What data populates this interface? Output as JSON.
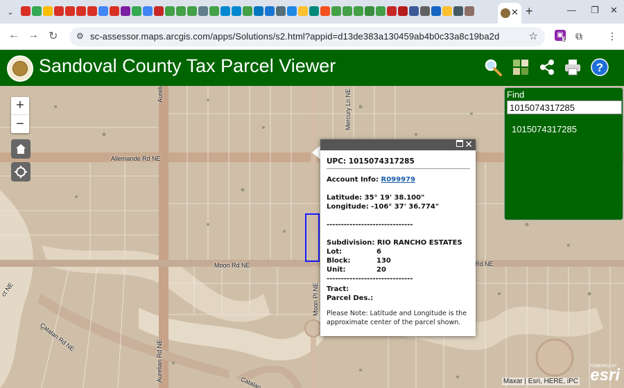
{
  "browser": {
    "url": "sc-assessor.maps.arcgis.com/apps/Solutions/s2.html?appid=d13de383a130459ab4b0c33a8c19ba2d",
    "favicon_colors": [
      "#d93025",
      "#34a853",
      "#fbbc04",
      "#d93025",
      "#d93025",
      "#d93025",
      "#d93025",
      "#4285f4",
      "#d93025",
      "#7b1fa2",
      "#34a853",
      "#4285f4",
      "#c62828",
      "#43a047",
      "#43a047",
      "#43a047",
      "#607d8b",
      "#43a047",
      "#0288d1",
      "#0288d1",
      "#43a047",
      "#0277bd",
      "#1976d2",
      "#546e7a",
      "#1e88e5",
      "#fbc02d",
      "#00897b",
      "#f4511e",
      "#43a047",
      "#43a047",
      "#43a047",
      "#388e3c",
      "#43a047",
      "#c62828",
      "#b71c1c",
      "#3b5998",
      "#616161",
      "#1565c0",
      "#fbc02d",
      "#455a64",
      "#8d6e63"
    ],
    "extension_badge": "3"
  },
  "header": {
    "title": "Sandoval County Tax Parcel Viewer",
    "bg_color": "#006400"
  },
  "map": {
    "roads": {
      "allemande": "Allemande Rd NE",
      "aurelian_top": "Aurelian Rd NE",
      "mercury": "Mercury Ln NE",
      "moon_left": "Moon Rd NE",
      "moon_right": "Moon Rd NE",
      "moon_pl": "Moon Pl NE",
      "catalan_left": "Catalan Rd NE",
      "aurelian_bottom": "Aurelian Rd NE",
      "catalan_bottom": "Catalan",
      "edge_left": "ct NE"
    },
    "attribution": "Maxar | Esri, HERE, iPC",
    "esri_powered": "POWERED BY",
    "esri_word": "esri"
  },
  "popup": {
    "title": "UPC: 1015074317285",
    "account_label": "Account Info:",
    "account_value": "R099979",
    "latitude": "Latitude: 35° 19' 38.100\"",
    "longitude": "Longitude: -106° 37' 36.774\"",
    "separator1": "------------------------------",
    "subdivision": "Subdivision: RIO RANCHO ESTATES",
    "lot_label": "Lot:",
    "lot_value": "6",
    "block_label": "Block:",
    "block_value": "130",
    "unit_label": "Unit:",
    "unit_value": "20",
    "separator2": "------------------------------",
    "tract": "Tract:",
    "parcel_des": "Parcel Des.:",
    "note": "Please Note: Latitude and Longitude is the approximate center of the parcel shown."
  },
  "find": {
    "label": "Find",
    "value": "1015074317285",
    "result": "1015074317285"
  },
  "icons": {
    "search": "search-icon",
    "basemap": "basemap-gallery-icon",
    "share": "share-icon",
    "print": "print-icon",
    "help": "help-icon"
  }
}
